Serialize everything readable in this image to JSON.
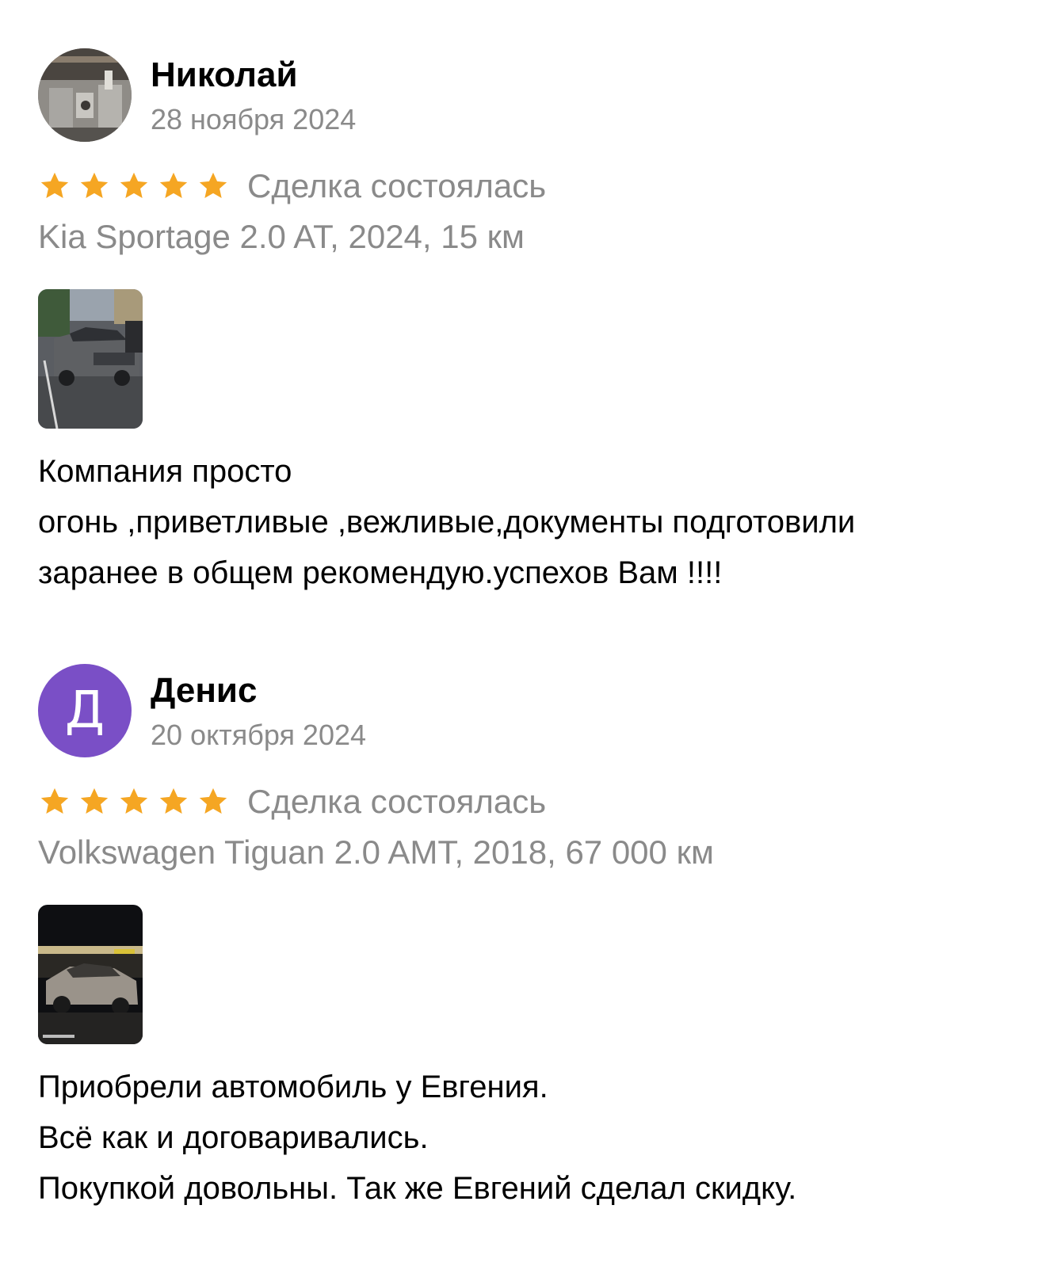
{
  "colors": {
    "star": "#f5a623",
    "secondary_text": "#8a8a8a",
    "avatar_letter_bg": "#7a4fc6"
  },
  "reviews": [
    {
      "author": "Николай",
      "date": "28 ноября 2024",
      "avatar_letter": "",
      "rating": 5,
      "deal_status": "Сделка состоялась",
      "car": "Kia Sportage 2.0 AT, 2024, 15 км",
      "text_lines": [
        "Компания просто",
        "огонь ,приветливые ,вежливые,документы подготовили",
        "заранее в общем рекомендую.успехов Вам !!!!"
      ]
    },
    {
      "author": "Денис",
      "date": "20 октября 2024",
      "avatar_letter": "Д",
      "rating": 5,
      "deal_status": "Сделка состоялась",
      "car": "Volkswagen Tiguan 2.0 AMT, 2018, 67 000 км",
      "text_lines": [
        "Приобрели автомобиль у Евгения.",
        "Всё как и договаривались.",
        "Покупкой довольны. Так же Евгений сделал скидку."
      ]
    }
  ]
}
